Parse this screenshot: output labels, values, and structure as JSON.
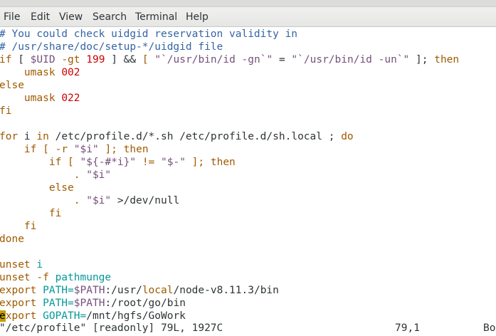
{
  "menu": [
    "File",
    "Edit",
    "View",
    "Search",
    "Terminal",
    "Help"
  ],
  "colors": {
    "comment": "#3465a4",
    "keyword": "#a05a00",
    "number": "#cc0000",
    "string": "#75507b",
    "variable": "#75507b",
    "identifier": "#06989a",
    "default": "#2e3436",
    "cursor": "#c4a000"
  },
  "lines": [
    [
      [
        "# You could check uidgid reservation validity in",
        "comment"
      ]
    ],
    [
      [
        "# /usr/share/doc/setup-*/uidgid file",
        "comment"
      ]
    ],
    [
      [
        "if",
        "keyword"
      ],
      [
        " [ ",
        "default"
      ],
      [
        "$UID",
        "variable"
      ],
      [
        " ",
        "default"
      ],
      [
        "-gt",
        "keyword"
      ],
      [
        " ",
        "default"
      ],
      [
        "199",
        "number"
      ],
      [
        " ] ",
        "default"
      ],
      [
        "&&",
        "default"
      ],
      [
        " [ ",
        "keyword"
      ],
      [
        "\"`/usr/bin/id -gn`\"",
        "string"
      ],
      [
        " = ",
        "default"
      ],
      [
        "\"`/usr/bin/id -un`\"",
        "string"
      ],
      [
        " ]; ",
        "default"
      ],
      [
        "then",
        "keyword"
      ]
    ],
    [
      [
        "    umask ",
        "keyword"
      ],
      [
        "002",
        "number"
      ]
    ],
    [
      [
        "else",
        "keyword"
      ]
    ],
    [
      [
        "    umask ",
        "keyword"
      ],
      [
        "022",
        "number"
      ]
    ],
    [
      [
        "fi",
        "keyword"
      ]
    ],
    [
      [
        "",
        "default"
      ]
    ],
    [
      [
        "for",
        "keyword"
      ],
      [
        " i ",
        "default"
      ],
      [
        "in",
        "keyword"
      ],
      [
        " /etc/profile.d/*.sh /etc/profile.d/sh.local ; ",
        "default"
      ],
      [
        "do",
        "keyword"
      ]
    ],
    [
      [
        "    ",
        "default"
      ],
      [
        "if",
        "keyword"
      ],
      [
        " [ ",
        "keyword"
      ],
      [
        "-r",
        "keyword"
      ],
      [
        " ",
        "default"
      ],
      [
        "\"$i\"",
        "string"
      ],
      [
        " ]; ",
        "keyword"
      ],
      [
        "then",
        "keyword"
      ]
    ],
    [
      [
        "        ",
        "default"
      ],
      [
        "if",
        "keyword"
      ],
      [
        " [ ",
        "keyword"
      ],
      [
        "\"${-#*i}\"",
        "string"
      ],
      [
        " != ",
        "keyword"
      ],
      [
        "\"$-\"",
        "string"
      ],
      [
        " ]; ",
        "keyword"
      ],
      [
        "then",
        "keyword"
      ]
    ],
    [
      [
        "            . ",
        "keyword"
      ],
      [
        "\"$i\"",
        "string"
      ]
    ],
    [
      [
        "        ",
        "default"
      ],
      [
        "else",
        "keyword"
      ]
    ],
    [
      [
        "            . ",
        "keyword"
      ],
      [
        "\"$i\"",
        "string"
      ],
      [
        " >/dev/null",
        "default"
      ]
    ],
    [
      [
        "        ",
        "default"
      ],
      [
        "fi",
        "keyword"
      ]
    ],
    [
      [
        "    ",
        "default"
      ],
      [
        "fi",
        "keyword"
      ]
    ],
    [
      [
        "done",
        "keyword"
      ]
    ],
    [
      [
        "",
        "default"
      ]
    ],
    [
      [
        "unset",
        "keyword"
      ],
      [
        " i",
        "identifier"
      ]
    ],
    [
      [
        "unset",
        "keyword"
      ],
      [
        " -f ",
        "keyword"
      ],
      [
        "pathmunge",
        "identifier"
      ]
    ],
    [
      [
        "export",
        "keyword"
      ],
      [
        " PATH=",
        "identifier"
      ],
      [
        "$PATH",
        "variable"
      ],
      [
        ":/usr/",
        "default"
      ],
      [
        "local",
        "keyword"
      ],
      [
        "/node-v8.11.3/bin",
        "default"
      ]
    ],
    [
      [
        "export",
        "keyword"
      ],
      [
        " PATH=",
        "identifier"
      ],
      [
        "$PATH",
        "variable"
      ],
      [
        ":/root/go/bin",
        "default"
      ]
    ],
    [
      [
        "e",
        "cursor"
      ],
      [
        "xport",
        "keyword"
      ],
      [
        " GOPATH=",
        "identifier"
      ],
      [
        "/mnt/hgfs/GoWork",
        "default"
      ]
    ]
  ],
  "status": {
    "file": "\"/etc/profile\" [readonly] 79L, 1927C",
    "position": "79,1",
    "scroll": "Bo"
  }
}
